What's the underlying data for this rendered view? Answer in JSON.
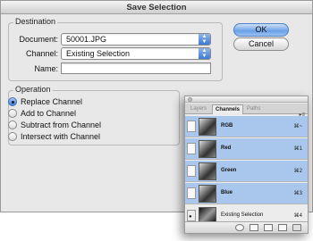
{
  "dialog": {
    "title": "Save Selection",
    "destination": {
      "legend": "Destination",
      "document_label": "Document:",
      "document_value": "50001.JPG",
      "channel_label": "Channel:",
      "channel_value": "Existing Selection",
      "name_label": "Name:",
      "name_value": ""
    },
    "operation": {
      "legend": "Operation",
      "options": [
        {
          "label": "Replace Channel",
          "checked": true
        },
        {
          "label": "Add to Channel",
          "checked": false
        },
        {
          "label": "Subtract from Channel",
          "checked": false
        },
        {
          "label": "Intersect with Channel",
          "checked": false
        }
      ]
    },
    "buttons": {
      "ok": "OK",
      "cancel": "Cancel"
    }
  },
  "channels_palette": {
    "tabs": [
      "Layers",
      "Channels",
      "Paths"
    ],
    "active_tab": "Channels",
    "rows": [
      {
        "name": "RGB",
        "shortcut": "⌘~"
      },
      {
        "name": "Red",
        "shortcut": "⌘1"
      },
      {
        "name": "Green",
        "shortcut": "⌘2"
      },
      {
        "name": "Blue",
        "shortcut": "⌘3"
      },
      {
        "name": "Existing Selection",
        "shortcut": "⌘4"
      }
    ]
  },
  "colors": {
    "accent": "#3d7ad6",
    "selected_row": "#a9c7ec",
    "dialog_bg": "#e8e8e8"
  }
}
